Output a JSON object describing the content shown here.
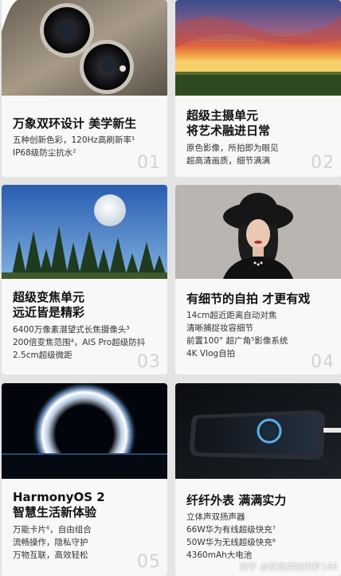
{
  "cards": [
    {
      "title": [
        "万象双环设计 美学新生"
      ],
      "lines": [
        "五种创新色彩，120Hz高刷新率¹",
        "IP68级防尘抗水²"
      ],
      "num": "01",
      "image": "phone-camera-module"
    },
    {
      "title": [
        "超级主摄单元",
        "将艺术融进日常"
      ],
      "lines": [
        "原色影像，所拍即为眼见",
        "超高清画质，细节满满"
      ],
      "num": "02",
      "image": "sunset-landscape"
    },
    {
      "title": [
        "超级变焦单元",
        "远近皆是精彩"
      ],
      "lines": [
        "6400万像素潜望式长焦摄像头³",
        "200倍变焦范围⁴，AIS Pro超级防抖",
        "2.5cm超级微距"
      ],
      "num": "03",
      "image": "moon-forest"
    },
    {
      "title": [
        "有细节的自拍 才更有戏"
      ],
      "lines": [
        "14cm超近距离自动对焦",
        "清晰捕捉妆容细节",
        "前置100° 超广角⁵影像系统",
        "4K Vlog自拍"
      ],
      "num": "04",
      "image": "portrait-woman-hat"
    },
    {
      "title": [
        "HarmonyOS 2",
        "智慧生活新体验"
      ],
      "lines": [
        "万能卡片⁶，自由组合",
        "流畅操作，隐私守护",
        "万物互联，高效轻松"
      ],
      "num": "05",
      "image": "glowing-ring"
    },
    {
      "title": [
        "纤纤外表  满满实力"
      ],
      "lines": [
        "立体声双扬声器",
        "66W华为有线超级快充⁷",
        "50W华为无线超级快充⁸",
        "4360mAh大电池"
      ],
      "num": "06",
      "image": "phone-charging"
    }
  ],
  "watermark": "知乎 @就是要饭的罗166",
  "colors": {
    "card_bg": "#f8f8f8",
    "page_bg": "#e4e4e4",
    "number": "#d2d2d2"
  }
}
